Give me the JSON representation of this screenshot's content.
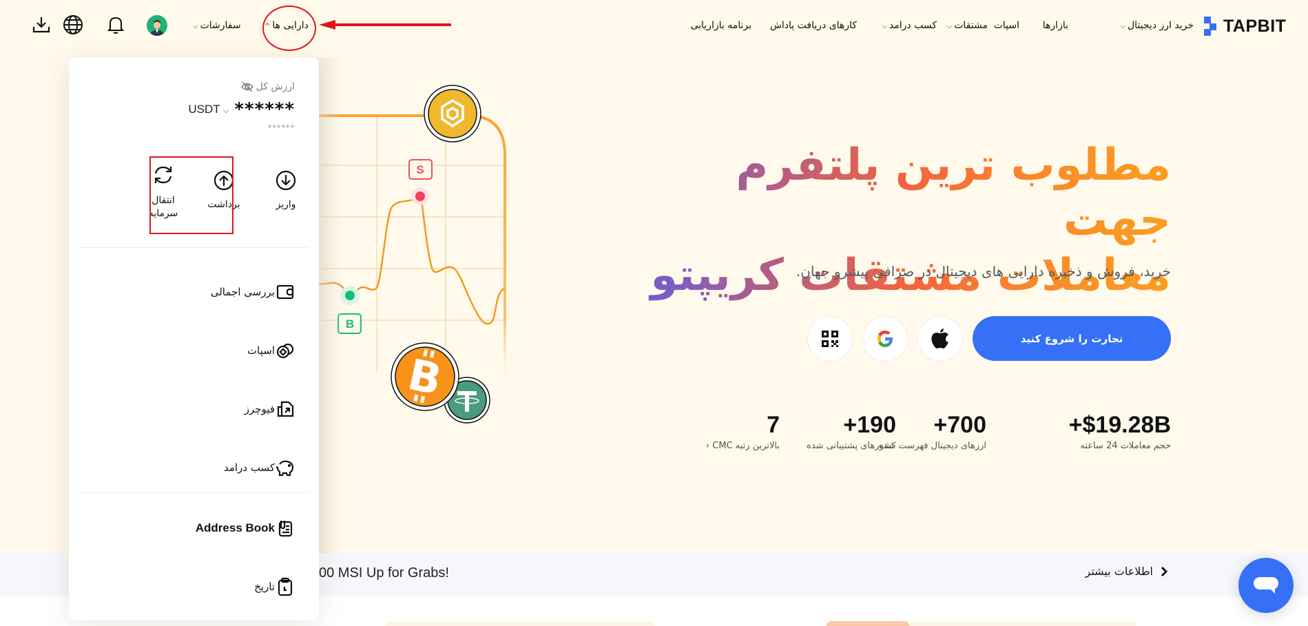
{
  "brand": {
    "name": "TAPBIT",
    "accent": "#3570f6"
  },
  "nav": {
    "items": [
      {
        "label": "خرید ارز دیجیتال",
        "dropdown": true
      },
      {
        "label": "بازارها",
        "dropdown": false
      },
      {
        "label": "اسپات",
        "dropdown": false
      },
      {
        "label": "مشتقات",
        "dropdown": true
      },
      {
        "label": "کسب درامد",
        "dropdown": true
      },
      {
        "label": "کارهای دریافت پاداش",
        "dropdown": false
      },
      {
        "label": "برنامه بازاریابی",
        "dropdown": false
      }
    ],
    "assets": {
      "label": "دارایی ها",
      "expanded": true
    },
    "orders": {
      "label": "سفارشات",
      "dropdown": true
    },
    "icons": [
      "avatar",
      "bell-icon",
      "globe-icon",
      "download-icon"
    ]
  },
  "assets_menu": {
    "total_label": "ارزش کل",
    "total_value": "******",
    "currency": "USDT",
    "sub_value": "******",
    "actions": [
      {
        "label": "واریز",
        "icon": "deposit-icon"
      },
      {
        "label": "برداشت",
        "icon": "withdraw-icon",
        "highlighted": true
      },
      {
        "label": "انتقال سرمایه",
        "icon": "transfer-icon"
      }
    ],
    "items": [
      {
        "label": "بررسی اجمالی",
        "icon": "wallet-icon"
      },
      {
        "label": "اسپات",
        "icon": "coins-icon"
      },
      {
        "label": "فیوچرز",
        "icon": "futures-icon"
      },
      {
        "label": "کسب درامد",
        "icon": "piggy-bank-icon"
      }
    ],
    "items2": [
      {
        "label": "Address Book",
        "icon": "address-book-icon"
      },
      {
        "label": "تاریخ",
        "icon": "history-icon"
      }
    ]
  },
  "hero": {
    "title_line1": "مطلوب ترین پلتفرم جهت",
    "title_line2": "معاملات مشتقات کریپتو",
    "subtitle": "خرید، فروش و ذخیره دارایی های دیجیتال در صرافی پیشرو جهان.",
    "cta": "تجارت را شروع کنید",
    "login_options": [
      "apple-icon",
      "google-icon",
      "qr-code-icon"
    ],
    "stats": [
      {
        "value": "+$19.28B",
        "caption": "حجم معاملات 24 ساعته"
      },
      {
        "value": "+700",
        "caption": "ارزهای دیجیتال فهرست شده"
      },
      {
        "value": "+190",
        "caption": "کشورهای پشتیبانی شده"
      },
      {
        "value": "7",
        "caption": "بالاترین رتبه CMC"
      }
    ],
    "illustration": {
      "sell_marker": "S",
      "buy_marker": "B",
      "coins": [
        "BNB",
        "BTC",
        "USDT"
      ]
    }
  },
  "banner": {
    "text": "00 MSI Up for Grabs!",
    "more_label": "اطلاعات بیشتر"
  },
  "annotations": {
    "circle_target": "assets-nav",
    "box_target": "withdraw-action",
    "color": "#e0141a"
  }
}
